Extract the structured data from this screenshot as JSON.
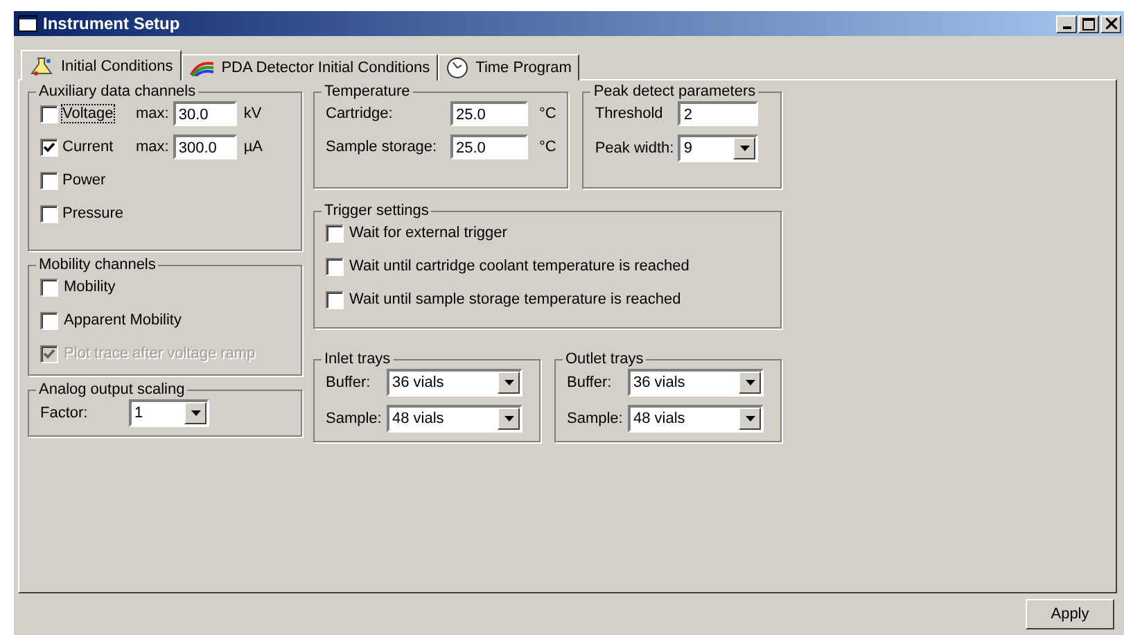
{
  "window": {
    "title": "Instrument Setup"
  },
  "tabs": [
    {
      "label": "Initial Conditions",
      "selected": true,
      "kind": "flask"
    },
    {
      "label": "PDA Detector Initial Conditions",
      "selected": false,
      "kind": "rainbow"
    },
    {
      "label": "Time Program",
      "selected": false,
      "kind": "clock"
    }
  ],
  "auxiliary": {
    "title": "Auxiliary data channels",
    "channels": [
      {
        "kind": "max",
        "label": "Voltage",
        "checked": false,
        "focused": true,
        "max_label": "max:",
        "value": "30.0",
        "unit": "kV"
      },
      {
        "kind": "max",
        "label": "Current",
        "checked": true,
        "focused": false,
        "max_label": "max:",
        "value": "300.0",
        "unit": "µA"
      },
      {
        "kind": "plain",
        "label": "Power",
        "checked": false,
        "focused": false
      },
      {
        "kind": "plain",
        "label": "Pressure",
        "checked": false,
        "focused": false
      }
    ]
  },
  "mobility": {
    "title": "Mobility channels",
    "items": [
      {
        "label": "Mobility",
        "checked": false,
        "disabled": false
      },
      {
        "label": "Apparent Mobility",
        "checked": false,
        "disabled": false
      },
      {
        "label": "Plot trace after voltage ramp",
        "checked": true,
        "disabled": true
      }
    ]
  },
  "analog": {
    "title": "Analog output scaling",
    "label": "Factor:",
    "value": "1"
  },
  "temperature": {
    "title": "Temperature",
    "rows": [
      {
        "label": "Cartridge:",
        "value": "25.0",
        "unit": "°C"
      },
      {
        "label": "Sample storage:",
        "value": "25.0",
        "unit": "°C"
      }
    ]
  },
  "peak": {
    "title": "Peak detect parameters",
    "rows": [
      {
        "kind": "text",
        "label": "Threshold",
        "value": "2"
      },
      {
        "kind": "dropdown",
        "label": "Peak width:",
        "value": "9"
      }
    ]
  },
  "trigger": {
    "title": "Trigger settings",
    "items": [
      {
        "label": "Wait for external trigger",
        "checked": false
      },
      {
        "label": "Wait until cartridge coolant temperature is reached",
        "checked": false
      },
      {
        "label": "Wait until sample storage temperature is reached",
        "checked": false
      }
    ]
  },
  "trays": [
    {
      "title": "Inlet trays",
      "rows": [
        {
          "label": "Buffer:",
          "value": "36 vials"
        },
        {
          "label": "Sample:",
          "value": "48 vials"
        }
      ]
    },
    {
      "title": "Outlet trays",
      "rows": [
        {
          "label": "Buffer:",
          "value": "36 vials"
        },
        {
          "label": "Sample:",
          "value": "48 vials"
        }
      ]
    }
  ],
  "apply_button": "Apply"
}
